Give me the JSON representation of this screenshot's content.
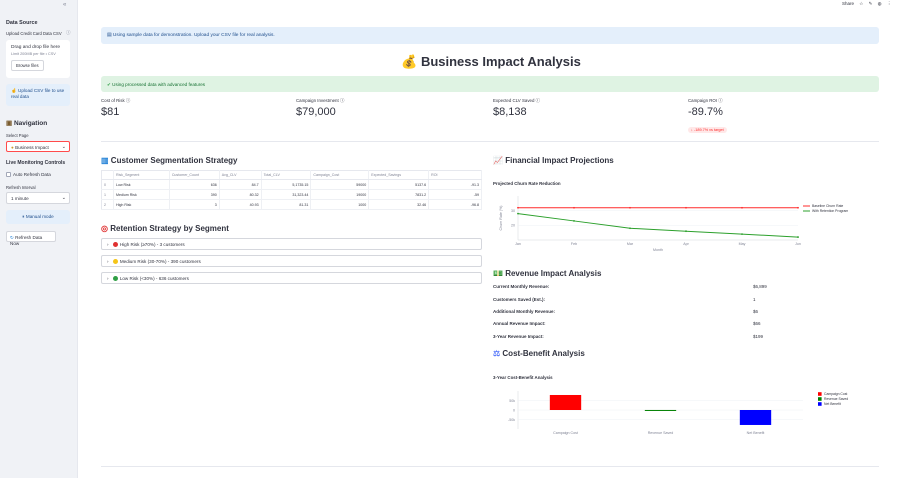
{
  "sidebar": {
    "collapse_icon": "«",
    "data_source_title": "Data Source",
    "upload_label": "Upload Credit Card Data CSV",
    "dropzone_title": "Drag and drop file here",
    "dropzone_limit": "Limit 200MB per file • CSV",
    "browse_label": "Browse files",
    "upload_hint": "Upload CSV file to use real data",
    "navigation_title": "Navigation",
    "select_page_label": "Select Page",
    "page_value": "Business Impact",
    "live_title": "Live Monitoring Controls",
    "auto_refresh_label": "Auto Refresh Data",
    "refresh_interval_label": "Refresh Interval",
    "refresh_interval_value": "1 minute",
    "manual_mode_label": "Manual mode",
    "refresh_now_label": "Refresh Data Now"
  },
  "topbar": {
    "share": "Share",
    "star_icon": "☆",
    "edit_icon": "✎",
    "github_icon": "◍",
    "menu_icon": "⋮"
  },
  "main": {
    "info_text": "Using sample data for demonstration. Upload your CSV file for real analysis.",
    "title": "Business Impact Analysis",
    "success_text": "Using processed data with advanced features",
    "metrics": [
      {
        "label": "Cost of Risk",
        "value": "$81",
        "delta": ""
      },
      {
        "label": "Campaign Investment",
        "value": "$79,000",
        "delta": ""
      },
      {
        "label": "Expected CLV Saved",
        "value": "$8,138",
        "delta": ""
      },
      {
        "label": "Campaign ROI",
        "value": "-89.7%",
        "delta": "↓ -189.7% vs target"
      }
    ],
    "segmentation": {
      "title": "Customer Segmentation Strategy",
      "columns": [
        "",
        "Risk_Segment",
        "Customer_Count",
        "Avg_CLV",
        "Total_CLV",
        "Campaign_Cost",
        "Expected_Savings",
        "ROI"
      ],
      "rows": [
        [
          "0",
          "Low Risk",
          "636",
          "84.7",
          "5,1735.15",
          "59000",
          "5137.6",
          "-91.3"
        ],
        [
          "1",
          "Medium Risk",
          "390",
          "80.32",
          "31,323.44",
          "19000",
          "7831.2",
          "-59"
        ],
        [
          "2",
          "High Risk",
          "3",
          "40.93",
          "81.31",
          "1000",
          "32.46",
          "-96.8"
        ]
      ]
    },
    "retention": {
      "title": "Retention Strategy by Segment",
      "items": [
        {
          "label": "High Risk (≥70%) - 3 customers",
          "color": "#e03131"
        },
        {
          "label": "Medium Risk (30-70%) - 390 customers",
          "color": "#f5c518"
        },
        {
          "label": "Low Risk (<30%) - 636 customers",
          "color": "#2f9e44"
        }
      ]
    },
    "financial": {
      "title": "Financial Impact Projections",
      "chart_title": "Projected Churn Rate Reduction",
      "ylabel": "Churn Rate (%)",
      "xlabel": "Month"
    },
    "revenue": {
      "title": "Revenue Impact Analysis",
      "rows": [
        {
          "label": "Current Monthly Revenue:",
          "value": "$6,899"
        },
        {
          "label": "Customers Saved (Est.):",
          "value": "1"
        },
        {
          "label": "Additional Monthly Revenue:",
          "value": "$6"
        },
        {
          "label": "Annual Revenue Impact:",
          "value": "$66"
        },
        {
          "label": "3-Year Revenue Impact:",
          "value": "$199"
        }
      ]
    },
    "cost_benefit": {
      "title": "Cost-Benefit Analysis",
      "chart_title": "3-Year Cost-Benefit Analysis"
    }
  },
  "chart_data": [
    {
      "type": "line",
      "title": "Projected Churn Rate Reduction",
      "xlabel": "Month",
      "ylabel": "Churn Rate (%)",
      "x": [
        "Jan",
        "Feb",
        "Mar",
        "Apr",
        "May",
        "Jun"
      ],
      "ylim": [
        10,
        40
      ],
      "yticks": [
        20,
        30
      ],
      "series": [
        {
          "name": "Baseline Churn Rate",
          "color": "#ff2b2b",
          "values": [
            32,
            32,
            32,
            32,
            32,
            32
          ]
        },
        {
          "name": "With Retention Program",
          "color": "#2ca02c",
          "values": [
            28,
            23,
            18,
            16,
            14,
            12
          ]
        }
      ],
      "legend": "right"
    },
    {
      "type": "bar",
      "title": "3-Year Cost-Benefit Analysis",
      "categories": [
        "Campaign Cost",
        "Revenue Saved",
        "Net Benefit"
      ],
      "values": [
        79000,
        199,
        -78801
      ],
      "colors": [
        "#ff0000",
        "#008000",
        "#0000ff"
      ],
      "ylim": [
        -100000,
        100000
      ],
      "yticks": [
        {
          "v": 50000,
          "label": "50k"
        },
        {
          "v": 0,
          "label": "0"
        },
        {
          "v": -50000,
          "label": "-50k"
        }
      ],
      "legend": "right"
    }
  ]
}
